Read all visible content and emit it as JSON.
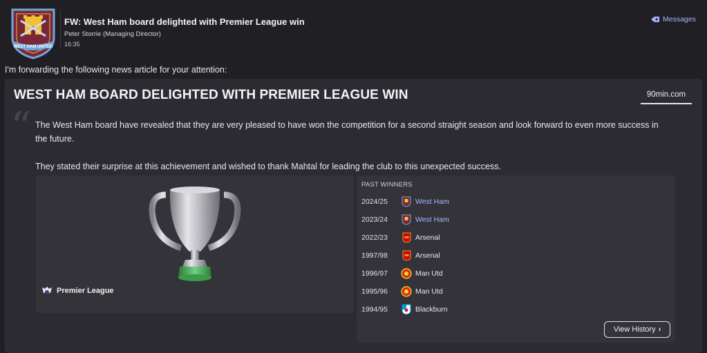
{
  "header": {
    "subject": "FW: West Ham board delighted with Premier League win",
    "sender": "Peter Storrie  (Managing Director)",
    "time": "16:35",
    "crest_icon": "west-ham-crest",
    "crest_text": "WEST HAM UNITED",
    "messages_label": "Messages"
  },
  "intro": "I'm forwarding the following news article for your attention:",
  "article": {
    "headline": "WEST HAM BOARD DELIGHTED WITH PREMIER LEAGUE WIN",
    "source": "90min.com",
    "paragraph1": "The West Ham board have revealed that they are very pleased to have won the competition for a second straight season and look forward to even more success in the future.",
    "paragraph2": "They stated their surprise at this achievement and wished to thank Mahtal for leading the club to this unexpected success.",
    "competition": "Premier League"
  },
  "past_winners": {
    "title": "PAST WINNERS",
    "rows": [
      {
        "season": "2024/25",
        "team": "West Ham",
        "badge": "west-ham"
      },
      {
        "season": "2023/24",
        "team": "West Ham",
        "badge": "west-ham"
      },
      {
        "season": "2022/23",
        "team": "Arsenal",
        "badge": "arsenal"
      },
      {
        "season": "1997/98",
        "team": "Arsenal",
        "badge": "arsenal"
      },
      {
        "season": "1996/97",
        "team": "Man Utd",
        "badge": "man-utd"
      },
      {
        "season": "1995/96",
        "team": "Man Utd",
        "badge": "man-utd"
      },
      {
        "season": "1994/95",
        "team": "Blackburn",
        "badge": "blackburn"
      }
    ],
    "view_history_label": "View History"
  },
  "colors": {
    "background": "#202024",
    "panel": "#2b2b31",
    "card": "#333339",
    "link": "#a9b6ff",
    "west_ham_claret": "#7a263a",
    "west_ham_blue": "#6fa8dc"
  }
}
